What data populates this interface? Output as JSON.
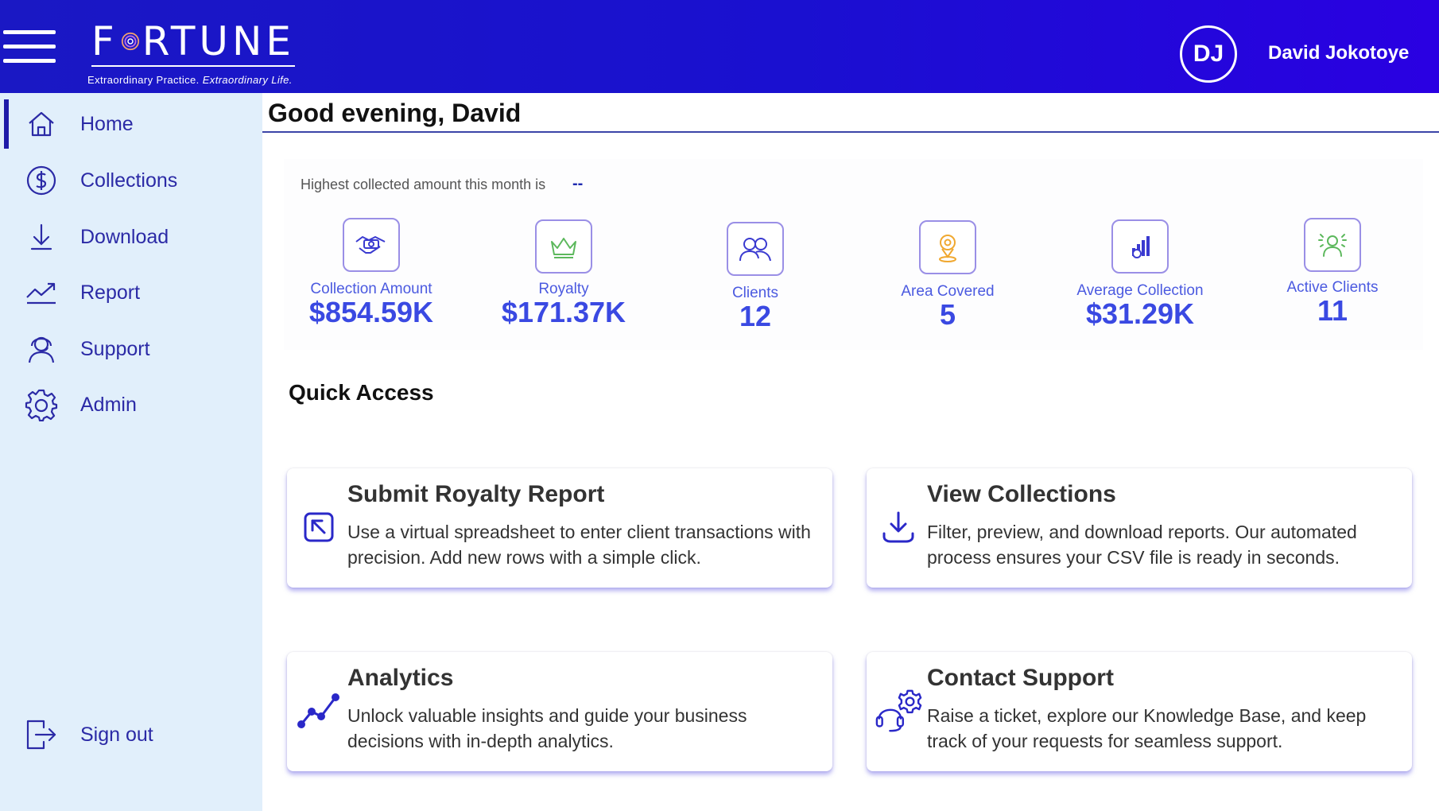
{
  "header": {
    "logo_text": "FORTUNE",
    "tagline_normal": "Extraordinary Practice.",
    "tagline_italic": "Extraordinary Life.",
    "avatar_initials": "DJ",
    "user_name": "David Jokotoye"
  },
  "sidebar": {
    "items": [
      {
        "label": "Home",
        "icon": "home-icon",
        "active": true
      },
      {
        "label": "Collections",
        "icon": "dollar-circle-icon"
      },
      {
        "label": "Download",
        "icon": "download-icon"
      },
      {
        "label": "Report",
        "icon": "trend-line-icon"
      },
      {
        "label": "Support",
        "icon": "support-agent-icon"
      },
      {
        "label": "Admin",
        "icon": "gear-icon"
      }
    ],
    "sign_out": {
      "label": "Sign out",
      "icon": "sign-out-icon"
    }
  },
  "main": {
    "greeting": "Good evening, David",
    "highest_text": "Highest collected amount this month is",
    "highest_value": "--",
    "stats": [
      {
        "label": "Collection Amount",
        "value": "$854.59K",
        "icon": "handshake-money-icon"
      },
      {
        "label": "Royalty",
        "value": "$171.37K",
        "icon": "crown-icon"
      },
      {
        "label": "Clients",
        "value": "12",
        "icon": "users-icon"
      },
      {
        "label": "Area Covered",
        "value": "5",
        "icon": "location-pin-icon"
      },
      {
        "label": "Average Collection",
        "value": "$31.29K",
        "icon": "bar-chart-icon"
      },
      {
        "label": "Active Clients",
        "value": "11",
        "icon": "active-user-icon"
      }
    ],
    "quick_access_title": "Quick Access",
    "cards": [
      {
        "title": "Submit Royalty Report",
        "description": "Use a virtual spreadsheet to enter client transactions with precision. Add new rows with a simple click.",
        "icon": "arrow-in-box-icon"
      },
      {
        "title": "View Collections",
        "description": "Filter, preview, and download reports. Our automated process ensures your CSV file is ready in seconds.",
        "icon": "download-tray-icon"
      },
      {
        "title": "Analytics",
        "description": "Unlock valuable insights and guide your business decisions with in-depth analytics.",
        "icon": "analytics-line-icon"
      },
      {
        "title": "Contact Support",
        "description": "Raise a ticket, explore our Knowledge Base, and keep track of your requests for seamless support.",
        "icon": "headset-gear-icon"
      }
    ]
  },
  "colors": {
    "header_blue": "#1a18c4",
    "sidebar_bg": "#e1effb",
    "accent": "#3a49e2",
    "nav_text": "#2b2aa6"
  }
}
